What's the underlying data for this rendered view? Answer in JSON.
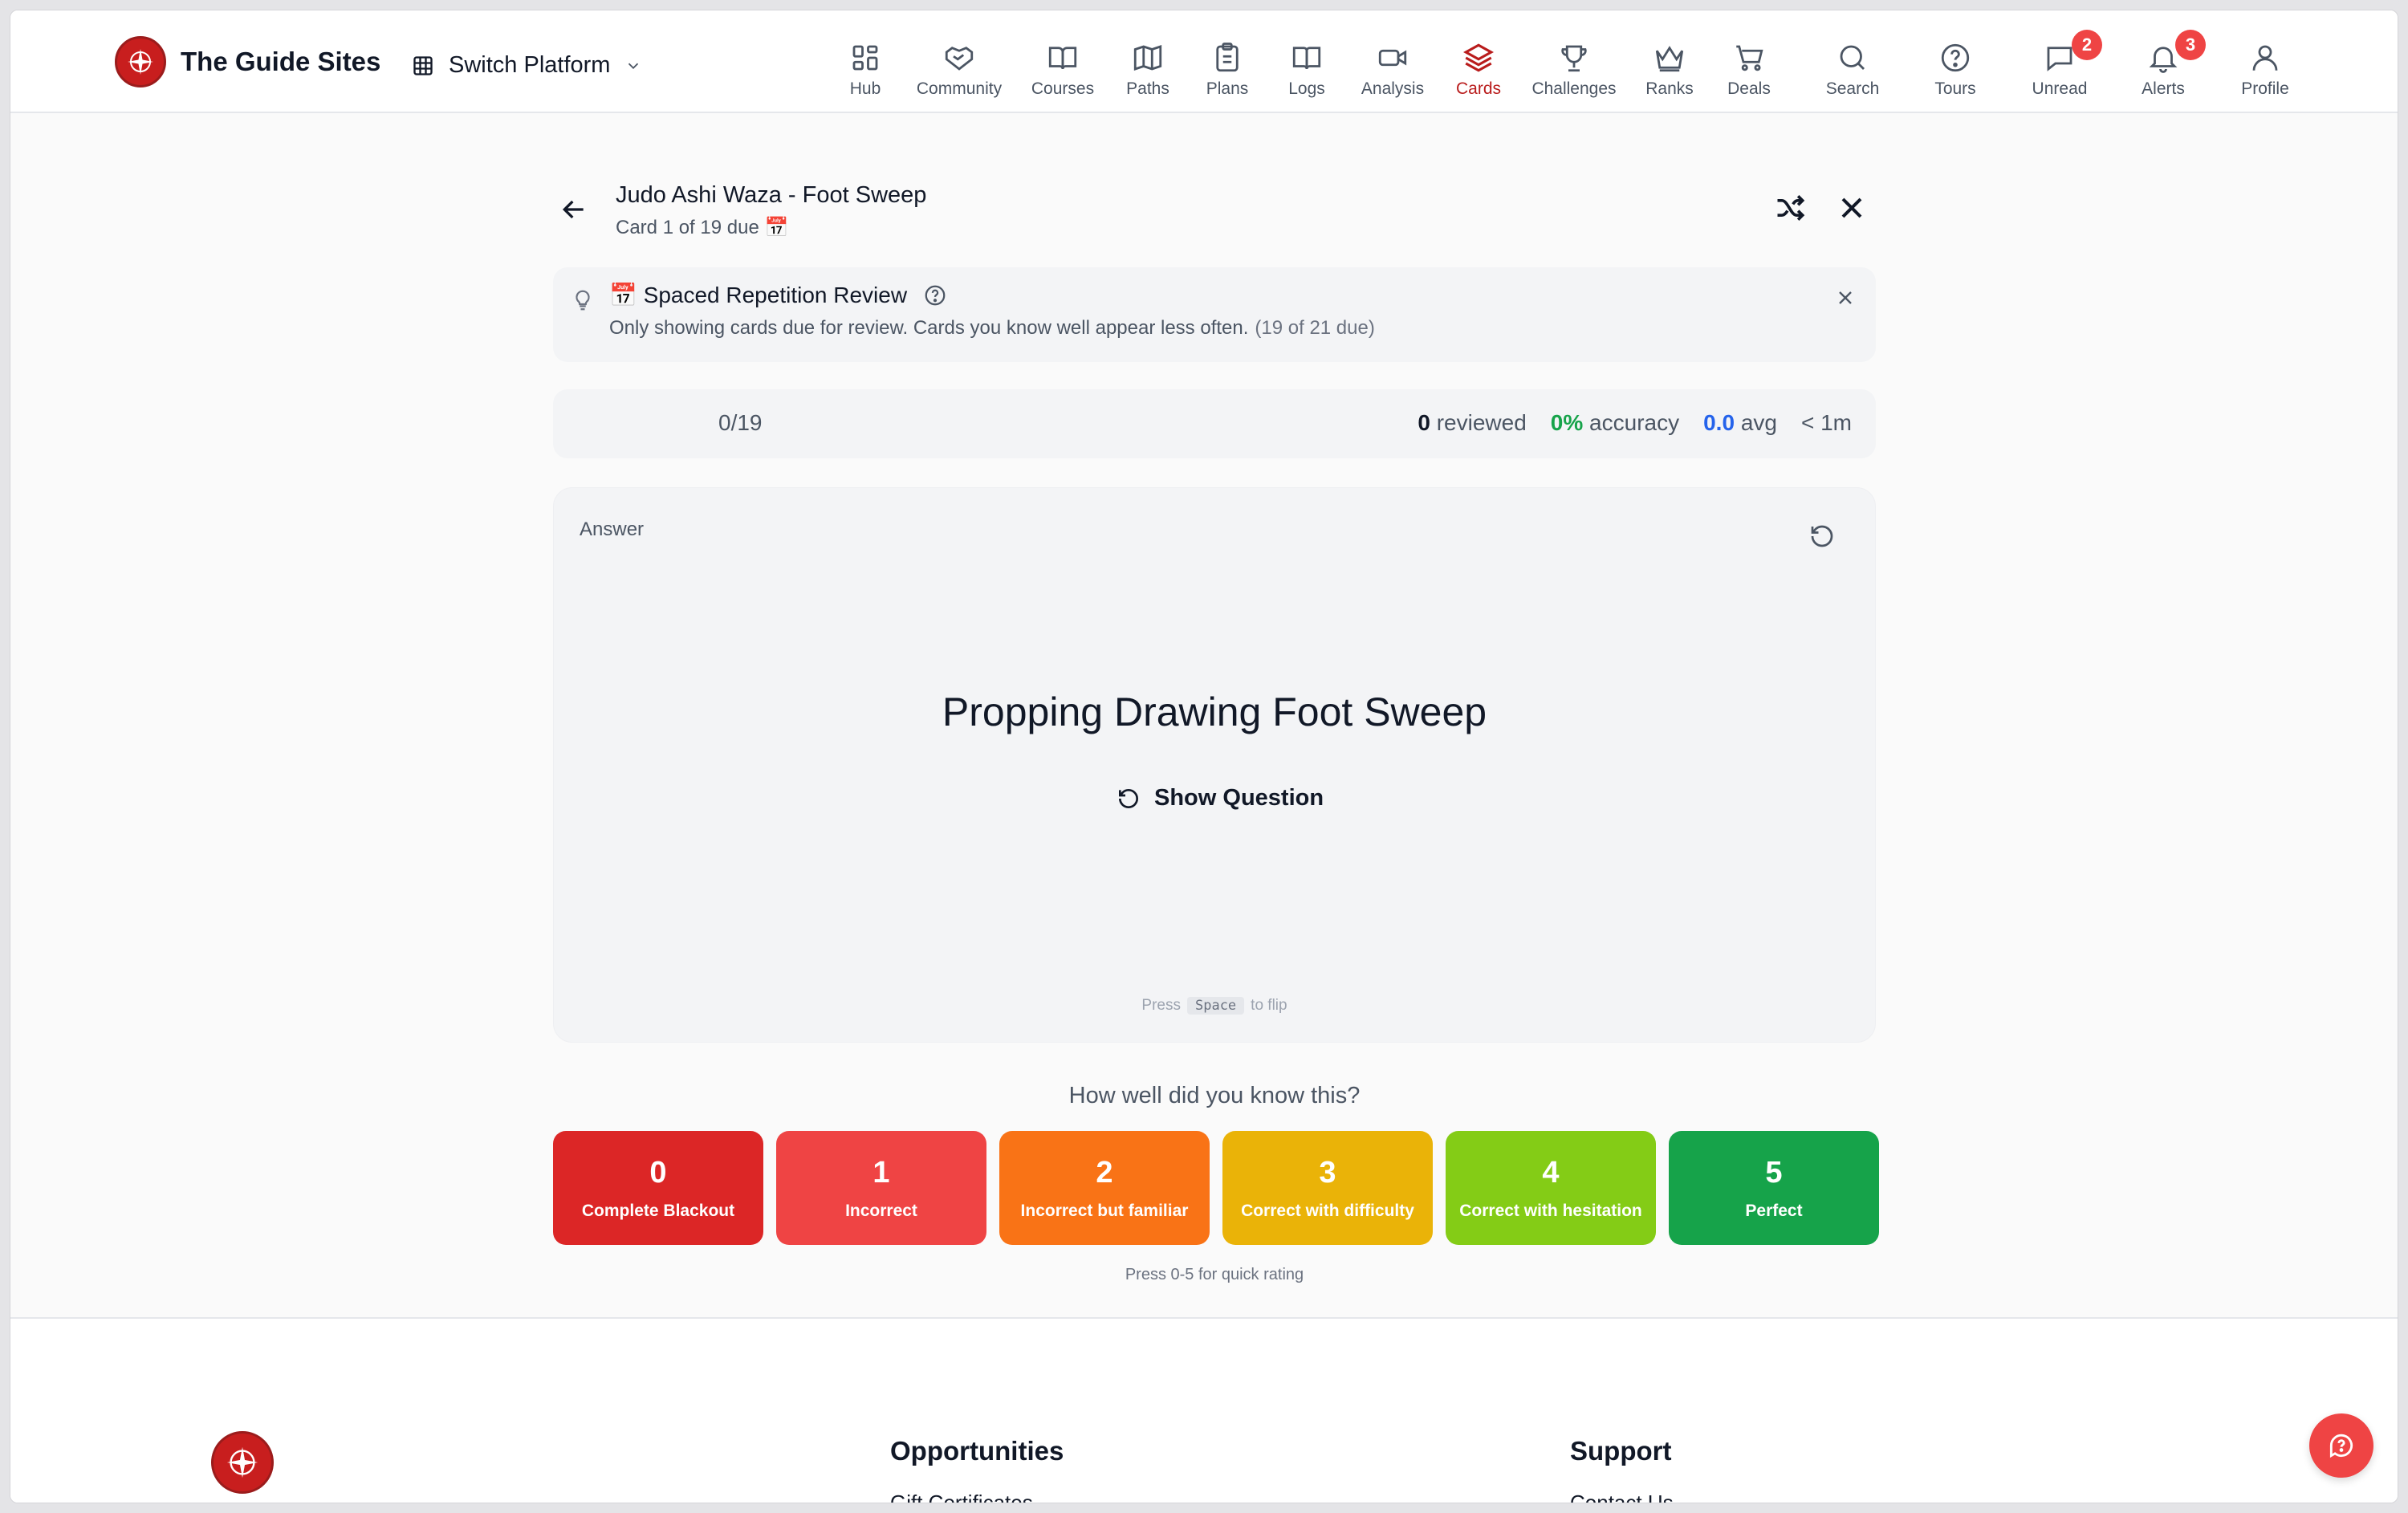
{
  "brand": {
    "name": "The Guide Sites"
  },
  "switch_platform": {
    "label": "Switch Platform"
  },
  "nav": [
    {
      "label": "Hub",
      "icon": "grid-icon"
    },
    {
      "label": "Community",
      "icon": "handshake-icon"
    },
    {
      "label": "Courses",
      "icon": "book-open-icon"
    },
    {
      "label": "Paths",
      "icon": "map-icon"
    },
    {
      "label": "Plans",
      "icon": "clipboard-icon"
    },
    {
      "label": "Logs",
      "icon": "book-icon"
    },
    {
      "label": "Analysis",
      "icon": "video-icon"
    },
    {
      "label": "Cards",
      "icon": "layers-icon",
      "active": true
    },
    {
      "label": "Challenges",
      "icon": "trophy-icon"
    },
    {
      "label": "Ranks",
      "icon": "crown-icon"
    },
    {
      "label": "Deals",
      "icon": "cart-icon"
    },
    {
      "label": "Search",
      "icon": "search-icon"
    },
    {
      "label": "Tours",
      "icon": "help-circle-icon"
    },
    {
      "label": "Unread",
      "icon": "message-icon",
      "badge": "2"
    },
    {
      "label": "Alerts",
      "icon": "bell-icon",
      "badge": "3"
    },
    {
      "label": "Profile",
      "icon": "user-icon"
    }
  ],
  "deck": {
    "title": "Judo Ashi Waza - Foot Sweep",
    "subtitle": "Card 1 of 19 due 📅"
  },
  "notice": {
    "title": "📅 Spaced Repetition Review",
    "description": "Only showing cards due for review. Cards you know well appear less often.",
    "due_note": "(19 of 21 due)"
  },
  "stats": {
    "progress_fraction": 0,
    "progress_text": "0/19",
    "reviewed_value": "0",
    "reviewed_label": "reviewed",
    "accuracy_value": "0%",
    "accuracy_label": "accuracy",
    "avg_value": "0.0",
    "avg_label": "avg",
    "time": "< 1m"
  },
  "card": {
    "side_label": "Answer",
    "content": "Propping Drawing Foot Sweep",
    "flip_label": "Show Question",
    "hint_prefix": "Press",
    "hint_key": "Space",
    "hint_suffix": "to flip"
  },
  "rating": {
    "question": "How well did you know this?",
    "options": [
      {
        "value": "0",
        "label": "Complete Blackout",
        "color": "#dc2626"
      },
      {
        "value": "1",
        "label": "Incorrect",
        "color": "#ef4444"
      },
      {
        "value": "2",
        "label": "Incorrect but familiar",
        "color": "#f97316"
      },
      {
        "value": "3",
        "label": "Correct with difficulty",
        "color": "#eab308"
      },
      {
        "value": "4",
        "label": "Correct with hesitation",
        "color": "#84cc16"
      },
      {
        "value": "5",
        "label": "Perfect",
        "color": "#16a34a"
      }
    ],
    "hint": "Press 0-5 for quick rating"
  },
  "footer": {
    "col1_title": "Opportunities",
    "col1_link": "Gift Certificates",
    "col2_title": "Support",
    "col2_link": "Contact Us"
  },
  "colors": {
    "accent": "#b91c1c",
    "brand_red": "#c81e1e"
  }
}
